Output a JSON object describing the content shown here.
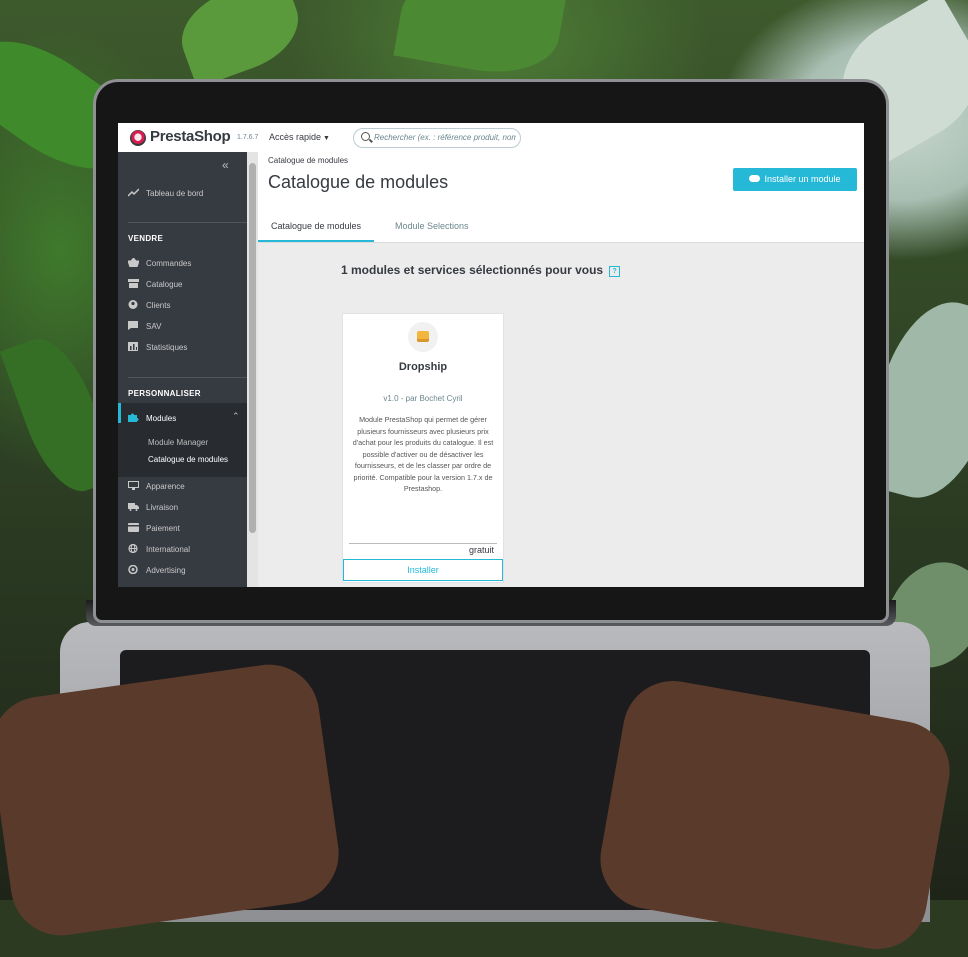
{
  "app": {
    "logo": "PrestaShop",
    "version": "1.7.6.7",
    "quick_access": "Accès rapide",
    "search_placeholder": "Rechercher (ex. : référence produit, nom"
  },
  "sidebar": {
    "dashboard": "Tableau de bord",
    "sell_section": "VENDRE",
    "sell_items": [
      "Commandes",
      "Catalogue",
      "Clients",
      "SAV",
      "Statistiques"
    ],
    "customize_section": "PERSONNALISER",
    "modules": "Modules",
    "module_sub_items": [
      "Module Manager",
      "Catalogue de modules"
    ],
    "customize_items": [
      "Apparence",
      "Livraison",
      "Paiement",
      "International",
      "Advertising"
    ]
  },
  "header": {
    "breadcrumb": "Catalogue de modules",
    "title": "Catalogue de modules",
    "install_button": "Installer un module",
    "tabs": [
      "Catalogue de modules",
      "Module Selections"
    ]
  },
  "main": {
    "selected_title": "1 modules et services sélectionnés pour vous",
    "help_label": "?"
  },
  "module_card": {
    "name": "Dropship",
    "version_author": "v1.0 - par Bochet Cyril",
    "description": "Module PrestaShop qui permet de gérer plusieurs fournisseurs avec plusieurs prix d'achat pour les produits du catalogue. Il est possible d'activer ou de désactiver les fournisseurs, et de les classer par ordre de priorité. Compatible pour la version 1.7.x de Prestashop.",
    "price": "gratuit",
    "install_label": "Installer"
  },
  "colors": {
    "accent": "#25b9d7",
    "sidebar": "#363a41",
    "brand": "#d81d51"
  }
}
